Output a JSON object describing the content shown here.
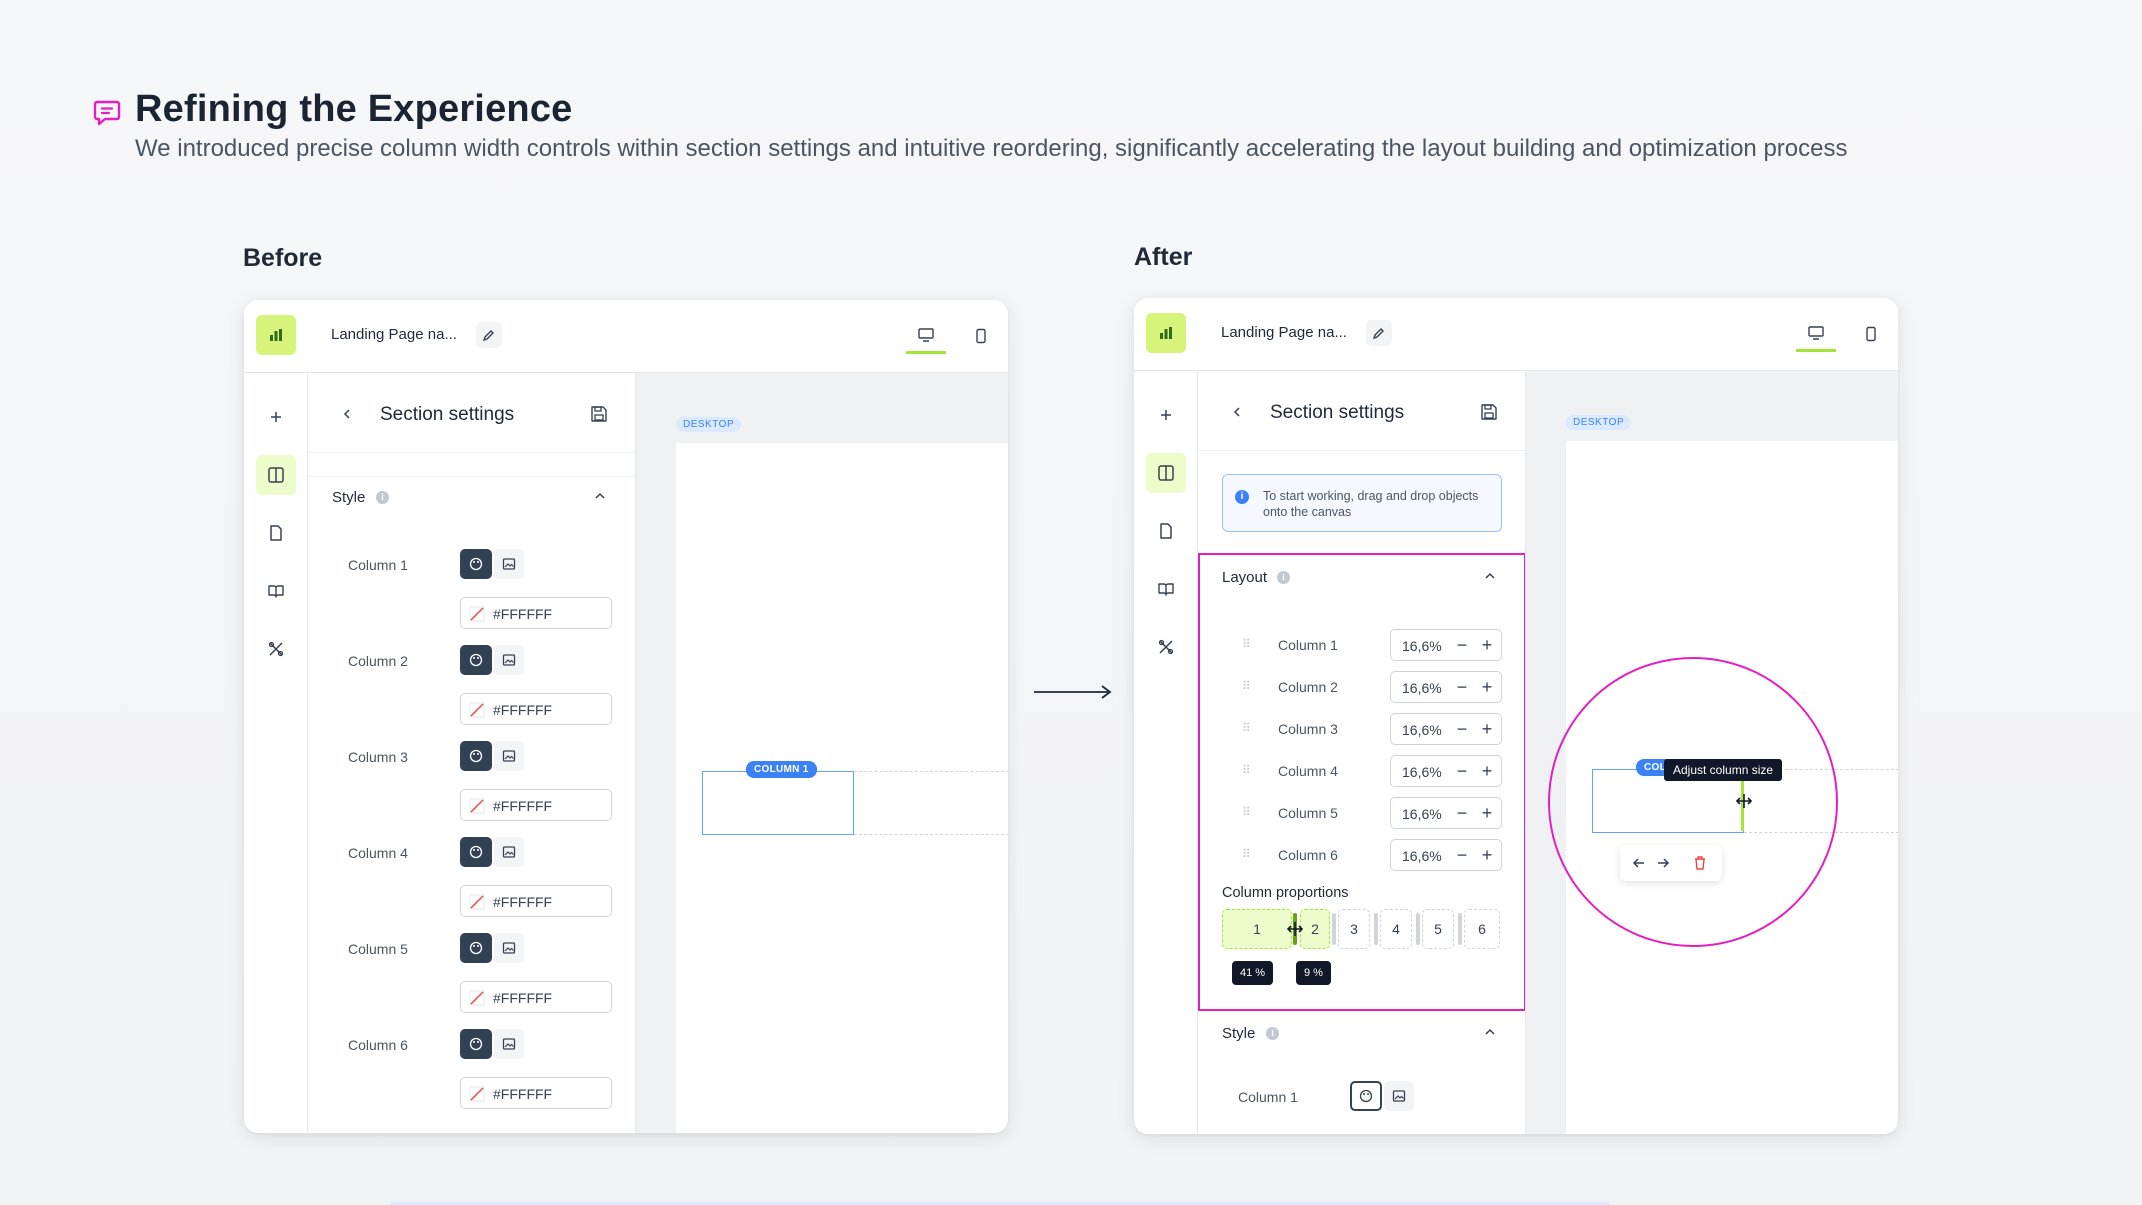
{
  "header": {
    "title": "Refining the Experience",
    "subtitle": "We introduced precise column width controls within section settings and intuitive reordering, significantly accelerating the layout building and optimization process"
  },
  "labels": {
    "before": "Before",
    "after": "After"
  },
  "editor": {
    "doc_title": "Landing Page na...",
    "panel_title": "Section settings",
    "canvas_tag": "DESKTOP",
    "column_tag": "COLUMN 1"
  },
  "before": {
    "style_title": "Style",
    "columns": [
      {
        "label": "Column 1",
        "color": "#FFFFFF"
      },
      {
        "label": "Column 2",
        "color": "#FFFFFF"
      },
      {
        "label": "Column 3",
        "color": "#FFFFFF"
      },
      {
        "label": "Column 4",
        "color": "#FFFFFF"
      },
      {
        "label": "Column 5",
        "color": "#FFFFFF"
      },
      {
        "label": "Column 6",
        "color": "#FFFFFF"
      }
    ]
  },
  "after": {
    "hint": "To start working, drag and drop objects onto the canvas",
    "layout_title": "Layout",
    "layout_columns": [
      {
        "label": "Column 1",
        "value": "16,6%"
      },
      {
        "label": "Column 2",
        "value": "16,6%"
      },
      {
        "label": "Column 3",
        "value": "16,6%"
      },
      {
        "label": "Column 4",
        "value": "16,6%"
      },
      {
        "label": "Column 5",
        "value": "16,6%"
      },
      {
        "label": "Column 6",
        "value": "16,6%"
      }
    ],
    "proportions_title": "Column proportions",
    "proportions": [
      "1",
      "2",
      "3",
      "4",
      "5",
      "6"
    ],
    "tip_left": "41 %",
    "tip_right": "9 %",
    "style_title": "Style",
    "style_column": "Column 1",
    "column_tag_partial": "COLU",
    "resize_tooltip": "Adjust column size",
    "minus": "−",
    "plus": "+"
  },
  "colors": {
    "accent_lime": "#d6f37a",
    "highlight_magenta": "#e41fc0",
    "selection_blue": "#3b82f6"
  }
}
